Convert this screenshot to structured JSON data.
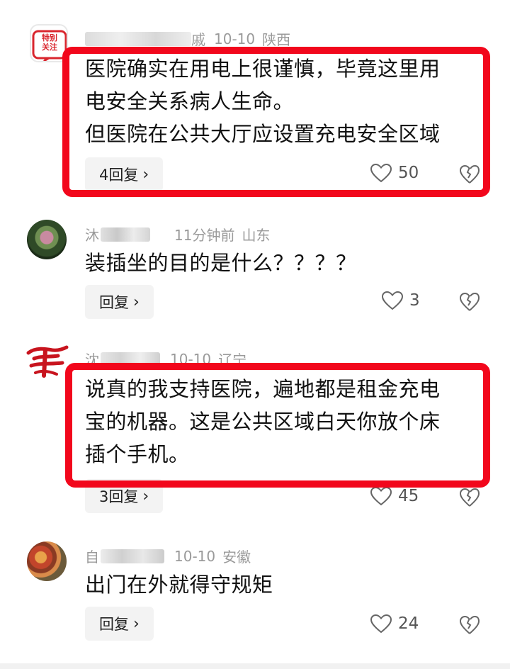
{
  "comments": [
    {
      "user_suffix": "戚",
      "time": "10-10",
      "location": "陕西",
      "badge_line1": "特别",
      "badge_line2": "关注",
      "lines": [
        "医院确实在用电上很谨慎，毕竟这里用",
        "电安全关系病人生命。",
        "但医院在公共大厅应设置充电安全区域"
      ],
      "reply_label": "4回复",
      "likes": "50"
    },
    {
      "user_prefix": "沐",
      "time": "11分钟前",
      "location": "山东",
      "lines": [
        "装插坐的目的是什么？？？？"
      ],
      "reply_label": "回复",
      "likes": "3"
    },
    {
      "user_prefix": "沈",
      "time": "10-10",
      "location": "辽宁",
      "lines": [
        "说真的我支持医院，遍地都是租金充电",
        "宝的机器。这是公共区域白天你放个床",
        "插个手机。"
      ],
      "reply_label": "3回复",
      "likes": "45"
    },
    {
      "user_prefix": "自",
      "time": "10-10",
      "location": "安徽",
      "lines": [
        "出门在外就得守规矩"
      ],
      "reply_label": "回复",
      "likes": "24"
    }
  ],
  "ui": {
    "reply_chevron": "›",
    "highlight_color": "#f2071c"
  }
}
